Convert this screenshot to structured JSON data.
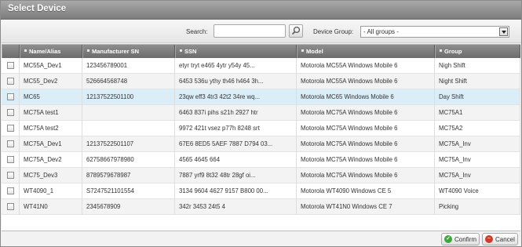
{
  "dialog": {
    "title": "Select Device"
  },
  "toolbar": {
    "search_label": "Search:",
    "search_value": "",
    "group_label": "Device Group:",
    "group_value": "- All groups -",
    "search_icon": "magnifier-icon",
    "dropdown_icon": "chevron-down-icon"
  },
  "columns": [
    "Name/Alias",
    "Manufacturer SN",
    "SSN",
    "Model",
    "Group"
  ],
  "rows": [
    {
      "name": "MC55A_Dev1",
      "mfg_sn": "123456789001",
      "ssn": "etyr tryt e465 4ytr y54y 45...",
      "model": "Motorola MC55A Windows Mobile 6",
      "group": "Nigh Shift"
    },
    {
      "name": "MC55_Dev2",
      "mfg_sn": "526664568748",
      "ssn": "6453 536u ythy th46 h464 3h...",
      "model": "Motorola MC55A Windows Mobile 6",
      "group": "Night Shift"
    },
    {
      "name": "MC65",
      "mfg_sn": "12137522501100",
      "ssn": "23qw eff3 4tr3 42t2 34re wq...",
      "model": "Motorola MC65 Windows Mobile 6",
      "group": "Day Shift"
    },
    {
      "name": "MC75A test1",
      "mfg_sn": "",
      "ssn": "6463 837i pihs s21h 2927 htr",
      "model": "Motorola MC75A Windows Mobile 6",
      "group": "MC75A1"
    },
    {
      "name": "MC75A test2",
      "mfg_sn": "",
      "ssn": "9972 421t vsez p77h 8248 srt",
      "model": "Motorola MC75A Windows Mobile 6",
      "group": "MC75A2"
    },
    {
      "name": "MC75A_Dev1",
      "mfg_sn": "12137522501107",
      "ssn": "67E6 8ED5 5AEF 7887 D794 03...",
      "model": "Motorola MC75A Windows Mobile 6",
      "group": "MC75A_Inv"
    },
    {
      "name": "MC75A_Dev2",
      "mfg_sn": "62758667978980",
      "ssn": "4565 4645 664",
      "model": "Motorola MC75A Windows Mobile 6",
      "group": "MC75A_Inv"
    },
    {
      "name": "MC75_Dev3",
      "mfg_sn": "8789579678987",
      "ssn": "7887 yrf9 8t32 48tr 28gf oi...",
      "model": "Motorola MC75A Windows Mobile 6",
      "group": "MC75A_Inv"
    },
    {
      "name": "WT4090_1",
      "mfg_sn": "S7247521101554",
      "ssn": "3134 9604 4627 9157 B800 00...",
      "model": "Motorola WT4090 Windows CE 5",
      "group": "WT4090 Voice"
    },
    {
      "name": "WT41N0",
      "mfg_sn": "2345678909",
      "ssn": "342r 3453 24t5 4",
      "model": "Motorola WT41N0 Windows CE 7",
      "group": "Picking"
    }
  ],
  "selected_row": 2,
  "footer": {
    "confirm_label": "Confirm",
    "cancel_label": "Cancel",
    "confirm_icon": "check-circle-icon",
    "cancel_icon": "no-entry-icon"
  },
  "colors": {
    "title_bar": "#8c8c8c",
    "header_bar": "#7a7a7a",
    "selected_row": "#dbeef8",
    "confirm_icon": "#3da63d",
    "cancel_icon": "#d23a2a"
  }
}
